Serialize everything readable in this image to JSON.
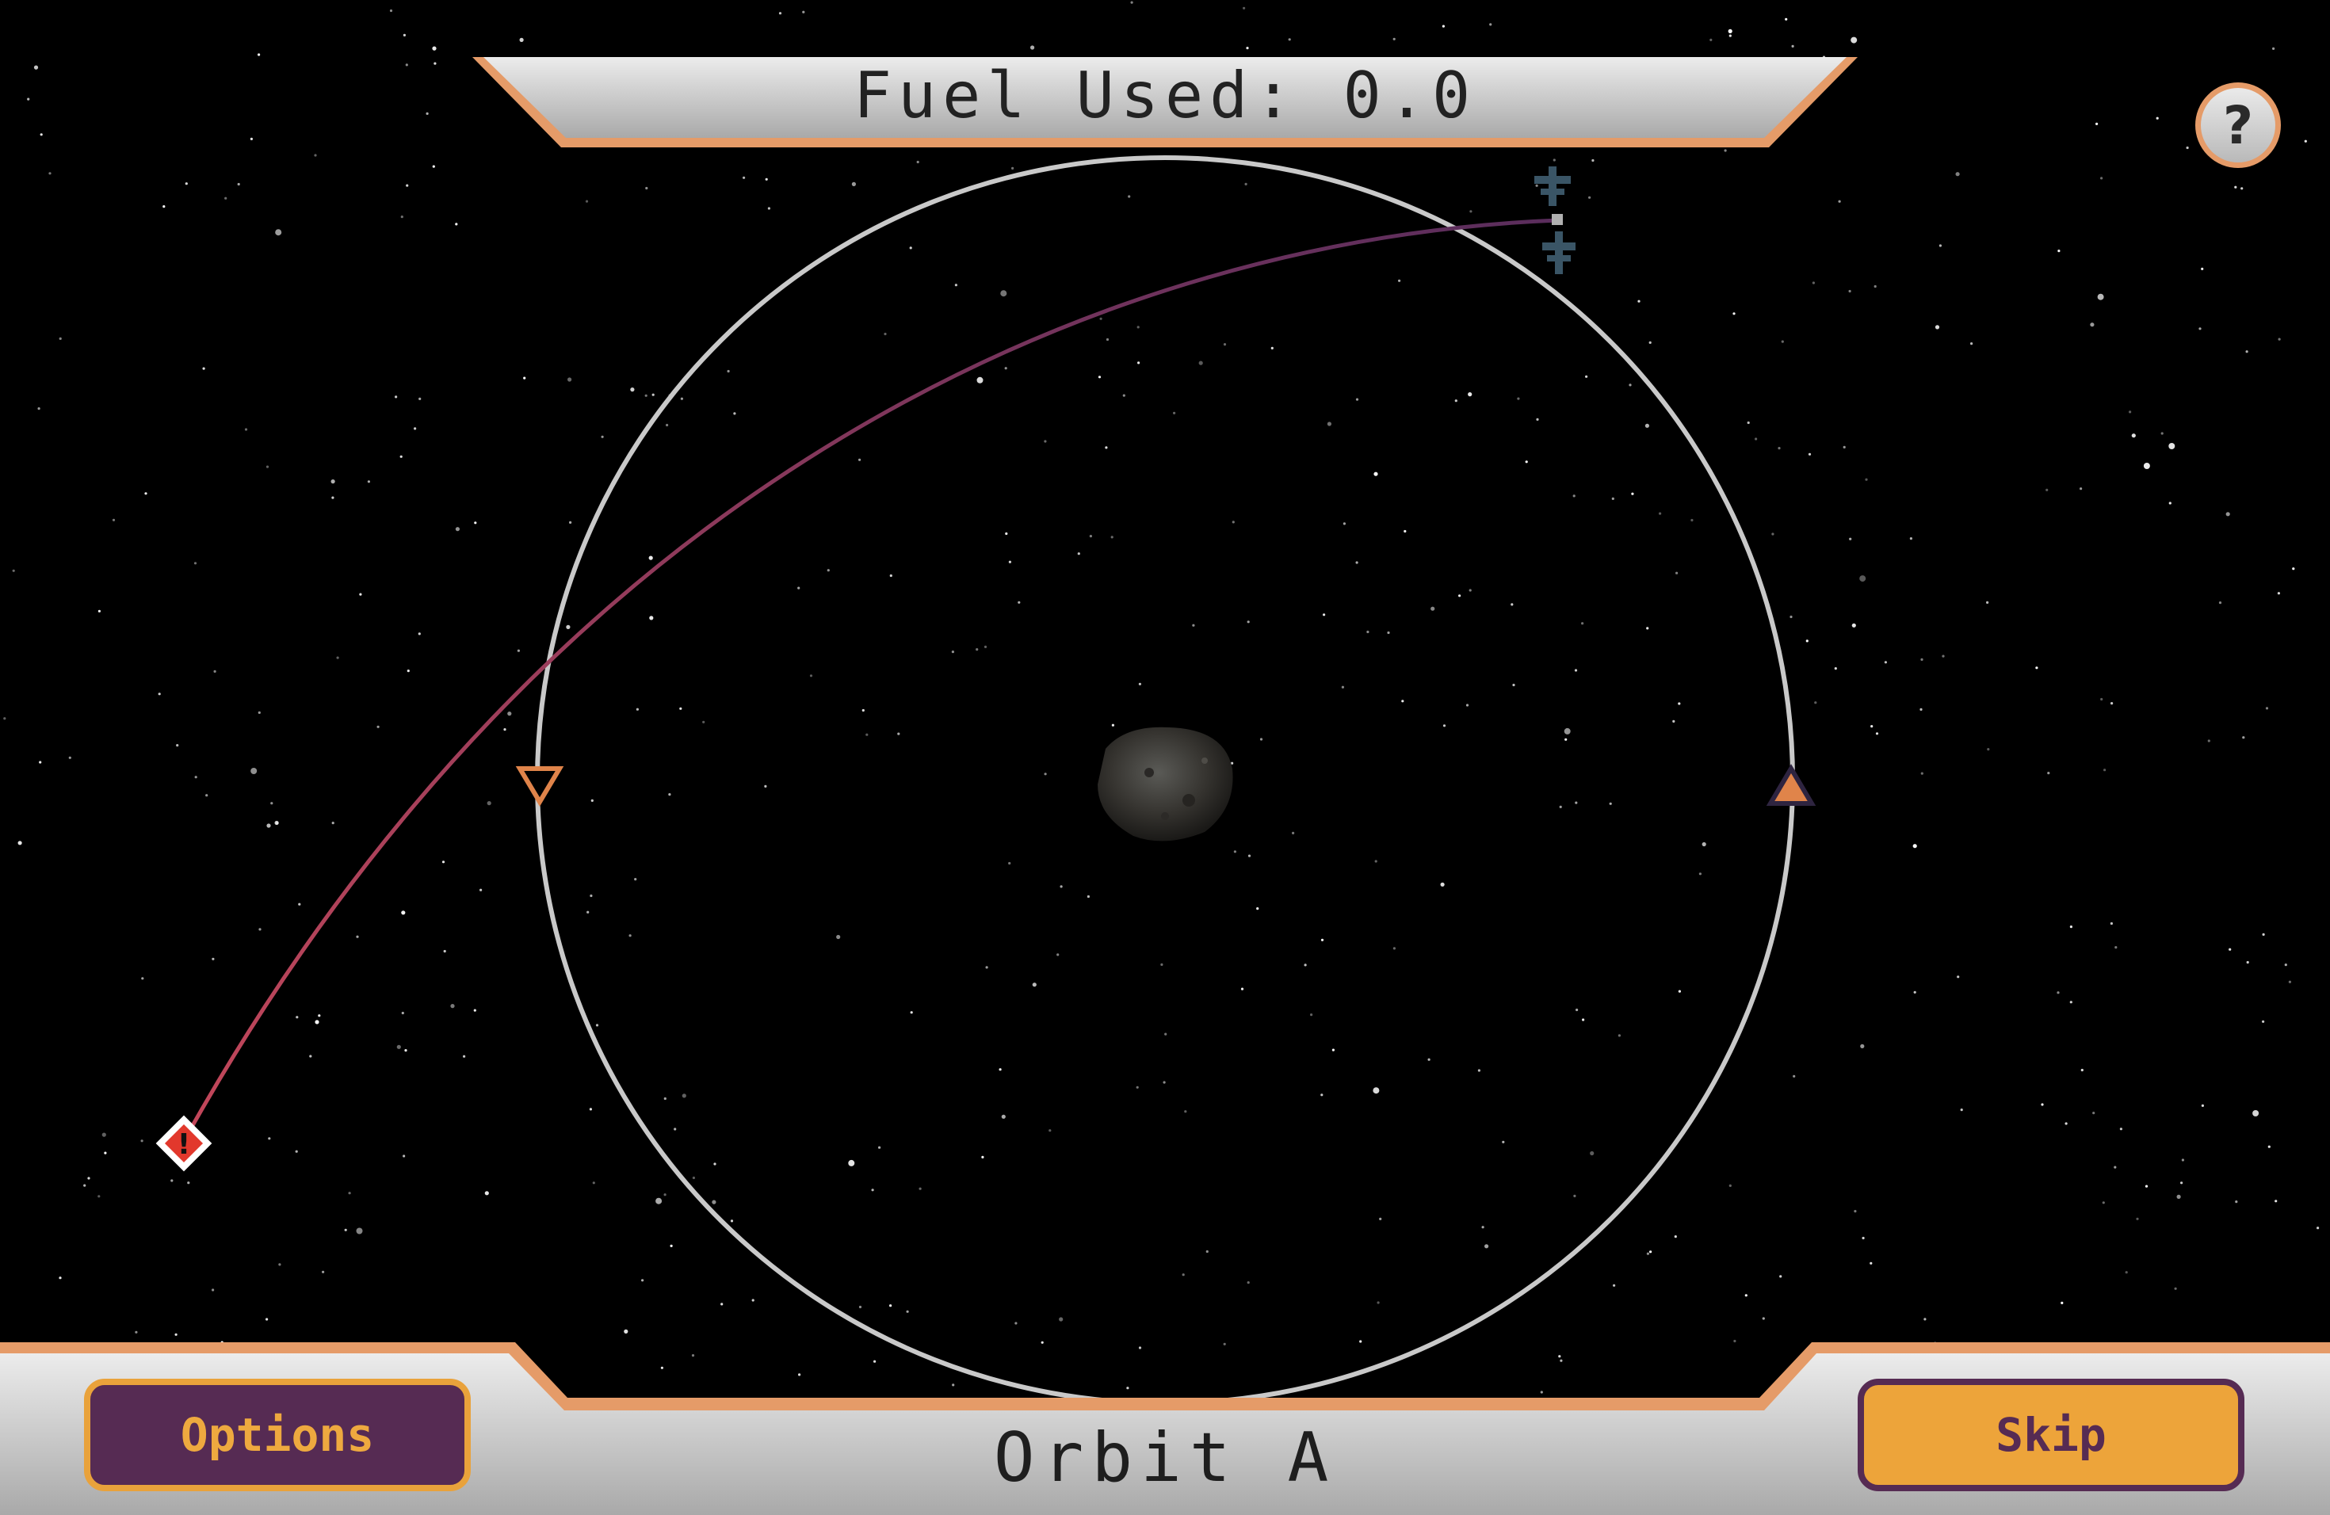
{
  "hud": {
    "fuel_label": "Fuel Used: 0.0",
    "help_label": "?",
    "orbit_title": "Orbit A",
    "options_label": "Options",
    "skip_label": "Skip"
  },
  "scene": {
    "warning_marker_label": "!",
    "icons": [
      "asteroid-icon",
      "satellite-icon",
      "warning-icon",
      "descending-node-icon",
      "ascending-node-icon"
    ]
  },
  "colors": {
    "panel_border": "#e59b68",
    "options_bg": "#562b53",
    "skip_bg": "#eda43a",
    "trajectory_start": "#5a2d5c",
    "trajectory_end": "#b83f55",
    "orbit_ring": "#c9c9c9"
  }
}
